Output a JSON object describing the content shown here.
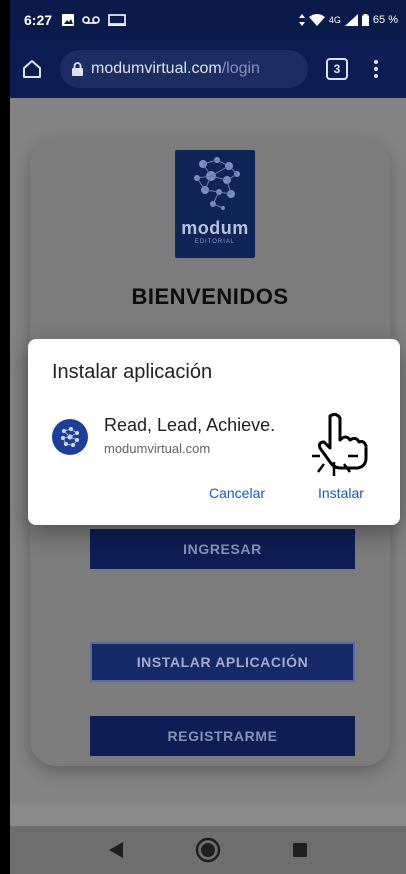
{
  "status_bar": {
    "time": "6:27",
    "network": "4G",
    "battery": "65 %"
  },
  "browser": {
    "url_domain": "modumvirtual.com",
    "url_path": "/login",
    "tab_count": "3"
  },
  "page": {
    "logo_word": "modum",
    "logo_sub": "EDITORIAL",
    "welcome": "BIENVENIDOS",
    "buttons": {
      "ingresar": "INGRESAR",
      "instalar": "INSTALAR APLICACIÓN",
      "registrar": "REGISTRARME"
    }
  },
  "dialog": {
    "title": "Instalar aplicación",
    "app_name": "Read, Lead, Achieve.",
    "app_url": "modumvirtual.com",
    "cancel_label": "Cancelar",
    "install_label": "Instalar"
  },
  "icons": {
    "home": "home-icon",
    "lock": "lock-icon",
    "back": "back-icon",
    "home_nav": "home-nav-icon",
    "recents": "recents-icon",
    "hand": "hand-pointer-icon"
  },
  "colors": {
    "status_bg": "#0a1a4a",
    "brand": "#0d1e55",
    "dialog_action": "#1a56c6"
  }
}
